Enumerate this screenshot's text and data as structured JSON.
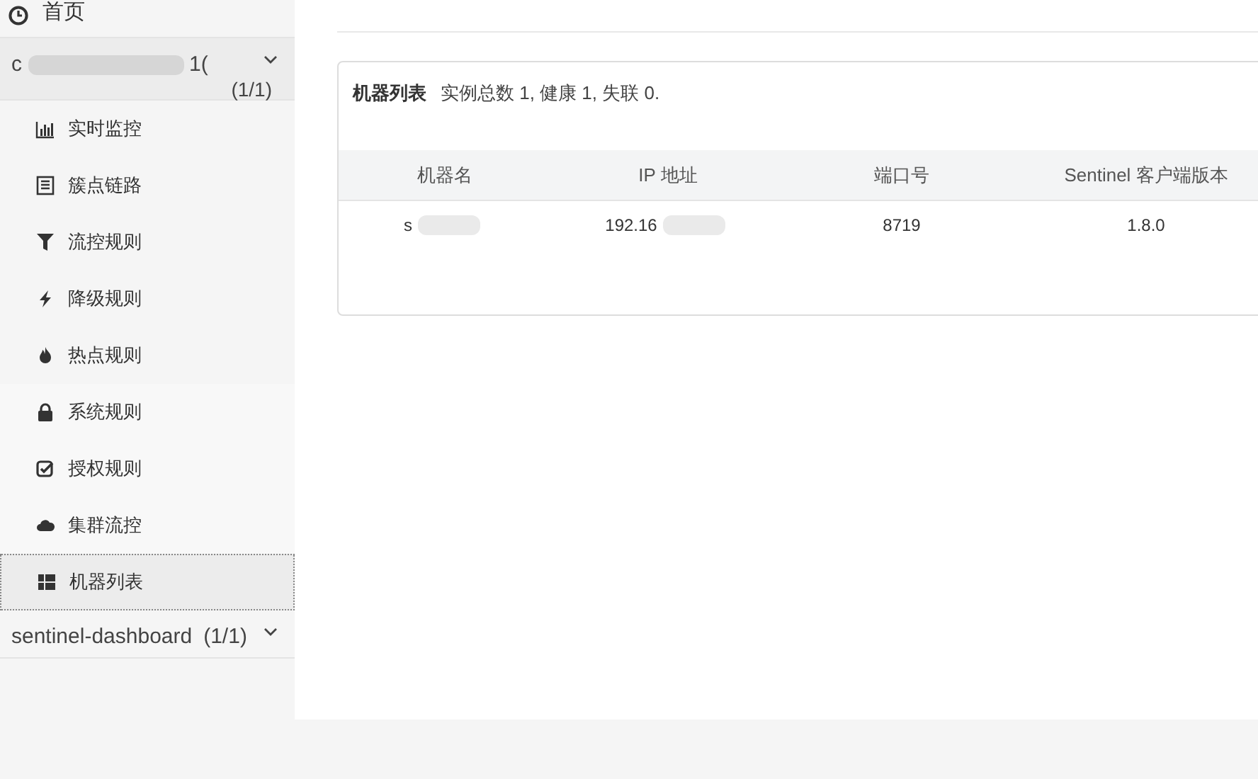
{
  "sidebar": {
    "home": {
      "label": "首页"
    },
    "groups": [
      {
        "title": "c",
        "title_tail": "1(",
        "redacted": true,
        "count": "(1/1)",
        "expanded": true,
        "items": [
          {
            "label": "实时监控",
            "kind": "bars",
            "selected": false
          },
          {
            "label": "簇点链路",
            "kind": "list",
            "selected": false
          },
          {
            "label": "流控规则",
            "kind": "filter",
            "selected": false
          },
          {
            "label": "降级规则",
            "kind": "bolt",
            "selected": false
          },
          {
            "label": "热点规则",
            "kind": "fire",
            "selected": false
          },
          {
            "label": "系统规则",
            "kind": "lock",
            "selected": false
          },
          {
            "label": "授权规则",
            "kind": "check",
            "selected": false
          },
          {
            "label": "集群流控",
            "kind": "cloud",
            "selected": false
          },
          {
            "label": "机器列表",
            "kind": "grid",
            "selected": true
          }
        ]
      },
      {
        "title": "sentinel-dashboard",
        "redacted": false,
        "count": "(1/1)",
        "expanded": false
      }
    ]
  },
  "panel": {
    "title": "机器列表",
    "summary": "实例总数 1, 健康 1, 失联 0.",
    "table": {
      "columns": [
        "机器名",
        "IP 地址",
        "端口号",
        "Sentinel 客户端版本"
      ],
      "rows": [
        {
          "cells": [
            {
              "text": "s",
              "redacted": true
            },
            {
              "text": "192.16",
              "redacted": true
            },
            {
              "text": "8719",
              "redacted": false
            },
            {
              "text": "1.8.0",
              "redacted": false
            }
          ]
        }
      ]
    }
  }
}
